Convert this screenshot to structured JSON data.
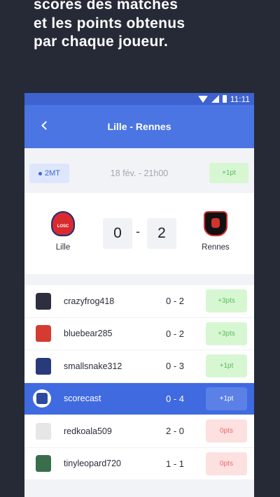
{
  "headline": [
    "scores des matches",
    "et les points obtenus",
    "par chaque joueur."
  ],
  "status": {
    "time": "11:11"
  },
  "appbar": {
    "title": "Lille - Rennes"
  },
  "match": {
    "round": "2MT",
    "date": "18 fév. - 21h00",
    "my_points": "+1pt",
    "home": {
      "name": "Lille",
      "score": "0"
    },
    "away": {
      "name": "Rennes",
      "score": "2"
    },
    "separator": "-"
  },
  "players": [
    {
      "name": "crazyfrog418",
      "prediction": "0 - 2",
      "points": "+3pts",
      "status": "green",
      "jersey": "#2d2f3f"
    },
    {
      "name": "bluebear285",
      "prediction": "0 - 2",
      "points": "+3pts",
      "status": "green",
      "jersey": "#d63b31"
    },
    {
      "name": "smallsnake312",
      "prediction": "0 - 3",
      "points": "+1pt",
      "status": "green",
      "jersey": "#283a7a"
    },
    {
      "name": "scorecast",
      "prediction": "0 - 4",
      "points": "+1pt",
      "status": "blue",
      "jersey": "#2c4aa0",
      "mine": true
    },
    {
      "name": "redkoala509",
      "prediction": "2 - 0",
      "points": "0pts",
      "status": "red",
      "jersey": "#e6e6e6"
    },
    {
      "name": "tinyleopard720",
      "prediction": "1 - 1",
      "points": "0pts",
      "status": "red",
      "jersey": "#3a6e4a"
    }
  ],
  "colors": {
    "accent": "#4a75e3",
    "background": "#262a36",
    "green": "#5bbc5e",
    "red": "#e86a6a"
  }
}
